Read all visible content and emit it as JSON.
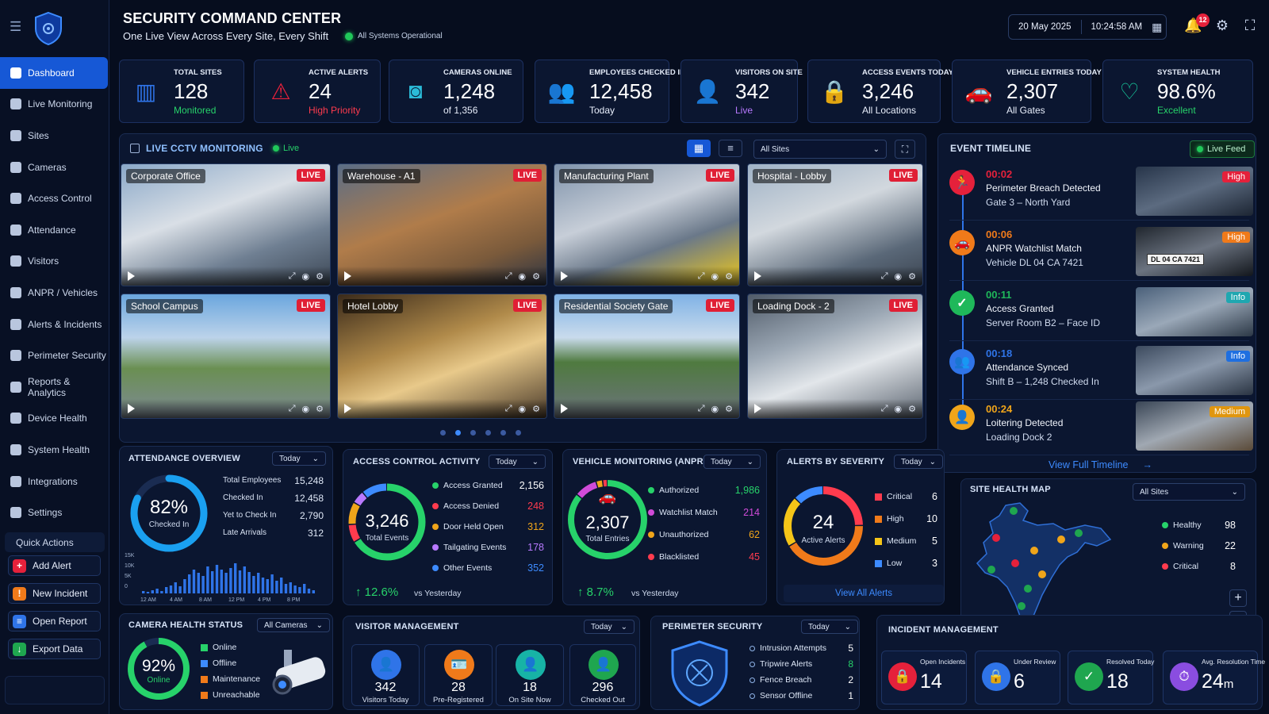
{
  "header": {
    "title": "SECURITY COMMAND CENTER",
    "subtitle": "One Live View Across Every Site, Every Shift",
    "status": "All Systems Operational",
    "date": "20 May 2025",
    "time": "10:24:58 AM",
    "notification_count": "12"
  },
  "sidebar": {
    "items": [
      {
        "label": "Dashboard",
        "icon": "dashboard-icon",
        "active": true
      },
      {
        "label": "Live Monitoring",
        "icon": "monitor-icon"
      },
      {
        "label": "Sites",
        "icon": "building-icon"
      },
      {
        "label": "Cameras",
        "icon": "camera-icon"
      },
      {
        "label": "Access Control",
        "icon": "lock-icon"
      },
      {
        "label": "Attendance",
        "icon": "user-icon"
      },
      {
        "label": "Visitors",
        "icon": "users-icon"
      },
      {
        "label": "ANPR / Vehicles",
        "icon": "car-icon"
      },
      {
        "label": "Alerts & Incidents",
        "icon": "warning-icon"
      },
      {
        "label": "Perimeter Security",
        "icon": "shield-icon"
      },
      {
        "label": "Reports & Analytics",
        "icon": "chart-icon"
      },
      {
        "label": "Device Health",
        "icon": "device-icon"
      },
      {
        "label": "System Health",
        "icon": "health-icon"
      },
      {
        "label": "Integrations",
        "icon": "plug-icon"
      },
      {
        "label": "Settings",
        "icon": "gear-icon"
      }
    ],
    "quick_actions_title": "Quick Actions",
    "quick_actions": [
      {
        "label": "Add Alert",
        "color": "#e5213b",
        "glyph": "+"
      },
      {
        "label": "New Incident",
        "color": "#f07a1a",
        "glyph": "!"
      },
      {
        "label": "Open Report",
        "color": "#2f74e8",
        "glyph": "≡"
      },
      {
        "label": "Export Data",
        "color": "#1fa64f",
        "glyph": "↓"
      }
    ]
  },
  "kpis": [
    {
      "label": "TOTAL SITES",
      "value": "128",
      "sub": "Monitored",
      "color": "#27d26a",
      "icon": "building-icon"
    },
    {
      "label": "ACTIVE ALERTS",
      "value": "24",
      "sub": "High Priority",
      "color": "#ff3b4e",
      "icon": "warning-icon"
    },
    {
      "label": "CAMERAS ONLINE",
      "value": "1,248",
      "sub": "of 1,356",
      "color": "#e8eefb",
      "icon": "camera-icon"
    },
    {
      "label": "EMPLOYEES CHECKED IN",
      "value": "12,458",
      "sub": "Today",
      "color": "#e8eefb",
      "icon": "users-icon"
    },
    {
      "label": "VISITORS ON SITE",
      "value": "342",
      "sub": "Live",
      "color": "#b879ff",
      "icon": "visitor-icon"
    },
    {
      "label": "ACCESS EVENTS TODAY",
      "value": "3,246",
      "sub": "All Locations",
      "color": "#e8eefb",
      "icon": "lock-icon"
    },
    {
      "label": "VEHICLE ENTRIES TODAY",
      "value": "2,307",
      "sub": "All Gates",
      "color": "#e8eefb",
      "icon": "car-icon"
    },
    {
      "label": "SYSTEM HEALTH",
      "value": "98.6%",
      "sub": "Excellent",
      "color": "#27d26a",
      "icon": "heartbeat-icon"
    }
  ],
  "cctv": {
    "title": "LIVE CCTV MONITORING",
    "live": "Live",
    "site_filter": "All Sites",
    "cameras": [
      {
        "name": "Corporate Office",
        "tag": "LIVE"
      },
      {
        "name": "Warehouse - A1",
        "tag": "LIVE"
      },
      {
        "name": "Manufacturing Plant",
        "tag": "LIVE"
      },
      {
        "name": "Hospital - Lobby",
        "tag": "LIVE"
      },
      {
        "name": "School Campus",
        "tag": "LIVE"
      },
      {
        "name": "Hotel Lobby",
        "tag": "LIVE"
      },
      {
        "name": "Residential Society Gate",
        "tag": "LIVE"
      },
      {
        "name": "Loading Dock - 2",
        "tag": "LIVE"
      }
    ]
  },
  "timeline": {
    "title": "EVENT TIMELINE",
    "feed": "Live Feed",
    "link": "View Full Timeline",
    "events": [
      {
        "time": "00:02",
        "title": "Perimeter Breach Detected",
        "detail": "Gate 3 – North Yard",
        "tag": "High",
        "color": "#e5213b",
        "tagColor": "#e5213b",
        "glyph": "🏃"
      },
      {
        "time": "00:06",
        "title": "ANPR Watchlist Match",
        "detail": "Vehicle DL 04 CA 7421",
        "tag": "High",
        "color": "#f07a1a",
        "tagColor": "#f07a1a",
        "glyph": "🚗",
        "plate": "DL 04 CA 7421"
      },
      {
        "time": "00:11",
        "title": "Access Granted",
        "detail": "Server Room B2 – Face ID",
        "tag": "Info",
        "color": "#1fb85a",
        "tagColor": "#1fa7b0",
        "glyph": "✓"
      },
      {
        "time": "00:18",
        "title": "Attendance Synced",
        "detail": "Shift B – 1,248 Checked In",
        "tag": "Info",
        "color": "#2f74e8",
        "tagColor": "#1f6fe0",
        "glyph": "👥"
      },
      {
        "time": "00:24",
        "title": "Loitering Detected",
        "detail": "Loading Dock 2",
        "tag": "Medium",
        "color": "#f0a51a",
        "tagColor": "#e0960f",
        "glyph": "👤"
      }
    ]
  },
  "attendance": {
    "title": "ATTENDANCE OVERVIEW",
    "filter": "Today",
    "percent": "82%",
    "percent_label": "Checked In",
    "percent_value": 0.82,
    "rows": [
      {
        "label": "Total Employees",
        "value": "15,248"
      },
      {
        "label": "Checked In",
        "value": "12,458"
      },
      {
        "label": "Yet to Check In",
        "value": "2,790"
      },
      {
        "label": "Late Arrivals",
        "value": "312"
      }
    ],
    "yticks": [
      "15K",
      "10K",
      "5K",
      "0"
    ],
    "xticks": [
      "12 AM",
      "4 AM",
      "8 AM",
      "12 PM",
      "4 PM",
      "8 PM"
    ]
  },
  "access": {
    "title": "ACCESS CONTROL ACTIVITY",
    "filter": "Today",
    "total": "3,246",
    "total_label": "Total Events",
    "change": "12.6%",
    "vs": "vs Yesterday",
    "rows": [
      {
        "label": "Access Granted",
        "value": "2,156",
        "color": "#27d26a"
      },
      {
        "label": "Access Denied",
        "value": "248",
        "color": "#ff3b4e"
      },
      {
        "label": "Door Held Open",
        "value": "312",
        "color": "#f0a51a"
      },
      {
        "label": "Tailgating Events",
        "value": "178",
        "color": "#b879ff"
      },
      {
        "label": "Other Events",
        "value": "352",
        "color": "#3d8bff"
      }
    ]
  },
  "vehicle": {
    "title": "VEHICLE MONITORING (ANPR)",
    "filter": "Today",
    "total": "2,307",
    "total_label": "Total Entries",
    "change": "8.7%",
    "vs": "vs Yesterday",
    "rows": [
      {
        "label": "Authorized",
        "value": "1,986",
        "color": "#27d26a"
      },
      {
        "label": "Watchlist Match",
        "value": "214",
        "color": "#d04bd8"
      },
      {
        "label": "Unauthorized",
        "value": "62",
        "color": "#f0a51a"
      },
      {
        "label": "Blacklisted",
        "value": "45",
        "color": "#ff3b4e"
      }
    ]
  },
  "alerts": {
    "title": "ALERTS BY SEVERITY",
    "filter": "Today",
    "total": "24",
    "total_label": "Active Alerts",
    "link": "View All Alerts",
    "rows": [
      {
        "label": "Critical",
        "value": "6",
        "color": "#ff3b4e"
      },
      {
        "label": "High",
        "value": "10",
        "color": "#f07a1a"
      },
      {
        "label": "Medium",
        "value": "5",
        "color": "#f5c518"
      },
      {
        "label": "Low",
        "value": "3",
        "color": "#3d8bff"
      }
    ]
  },
  "sitemap": {
    "title": "SITE HEALTH MAP",
    "filter": "All Sites",
    "rows": [
      {
        "label": "Healthy",
        "value": "98",
        "color": "#27d26a"
      },
      {
        "label": "Warning",
        "value": "22",
        "color": "#f0a51a"
      },
      {
        "label": "Critical",
        "value": "8",
        "color": "#ff3b4e"
      }
    ]
  },
  "camhealth": {
    "title": "CAMERA HEALTH STATUS",
    "filter": "All Cameras",
    "percent": "92%",
    "percent_label": "Online",
    "percent_value": 0.92,
    "rows": [
      {
        "label": "Online",
        "color": "#27d26a"
      },
      {
        "label": "Offline",
        "color": "#3d8bff"
      },
      {
        "label": "Maintenance",
        "color": "#f07a1a"
      },
      {
        "label": "Unreachable",
        "color": "#f07a1a"
      }
    ]
  },
  "visitors": {
    "title": "VISITOR MANAGEMENT",
    "filter": "Today",
    "tiles": [
      {
        "value": "342",
        "label": "Visitors Today",
        "color": "#2f74e8"
      },
      {
        "value": "28",
        "label": "Pre-Registered",
        "color": "#f07a1a"
      },
      {
        "value": "18",
        "label": "On Site Now",
        "color": "#17b3a6"
      },
      {
        "value": "296",
        "label": "Checked Out",
        "color": "#1fa64f"
      }
    ]
  },
  "perimeter": {
    "title": "PERIMETER SECURITY",
    "filter": "Today",
    "rows": [
      {
        "label": "Intrusion Attempts",
        "value": "5"
      },
      {
        "label": "Tripwire Alerts",
        "value": "8"
      },
      {
        "label": "Fence Breach",
        "value": "2"
      },
      {
        "label": "Sensor Offline",
        "value": "1"
      }
    ]
  },
  "incidents": {
    "title": "INCIDENT MANAGEMENT",
    "tiles": [
      {
        "label": "Open Incidents",
        "value": "14",
        "color": "#e5213b"
      },
      {
        "label": "Under Review",
        "value": "6",
        "color": "#2f74e8"
      },
      {
        "label": "Resolved Today",
        "value": "18",
        "color": "#1fa64f"
      },
      {
        "label": "Avg. Resolution Time",
        "value": "24",
        "unit": "m",
        "color": "#8a4de0"
      }
    ]
  }
}
